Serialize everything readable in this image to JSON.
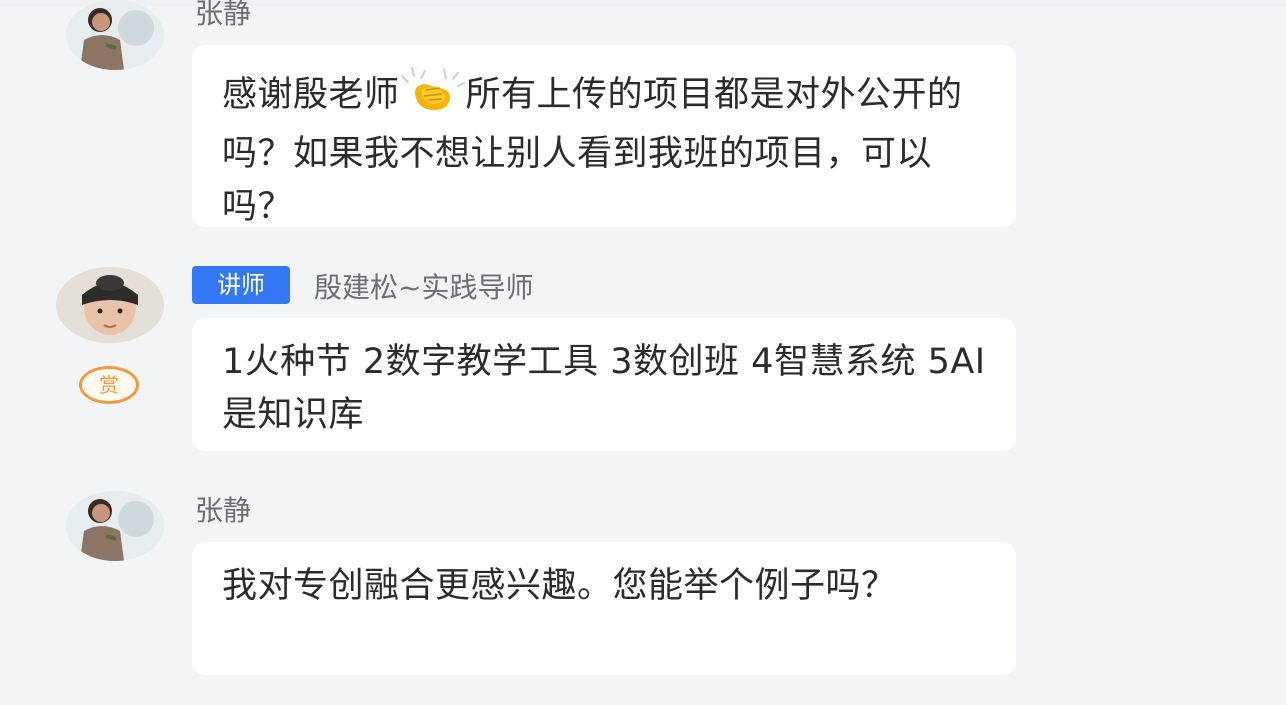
{
  "messages": [
    {
      "sender": "张静",
      "text_before_emoji": "感谢殷老师",
      "emoji": "clapping-hands-emoji",
      "text_after_emoji": "所有上传的项目都是对外公开的吗？如果我不想让别人看到我班的项目，可以吗？"
    },
    {
      "badge": "讲师",
      "sender": "殷建松~实践导师",
      "reward_label": "赏",
      "text": "1火种节 2数字教学工具 3数创班 4智慧系统 5AI是知识库"
    },
    {
      "sender": "张静",
      "text": "我对专创融合更感兴趣。您能举个例子吗？"
    }
  ],
  "colors": {
    "background": "#f3f4f6",
    "bubble": "#ffffff",
    "badge": "#3478f6",
    "reward": "#f09a3c",
    "sender_text": "#6e6e73",
    "message_text": "#2b2b2b"
  }
}
